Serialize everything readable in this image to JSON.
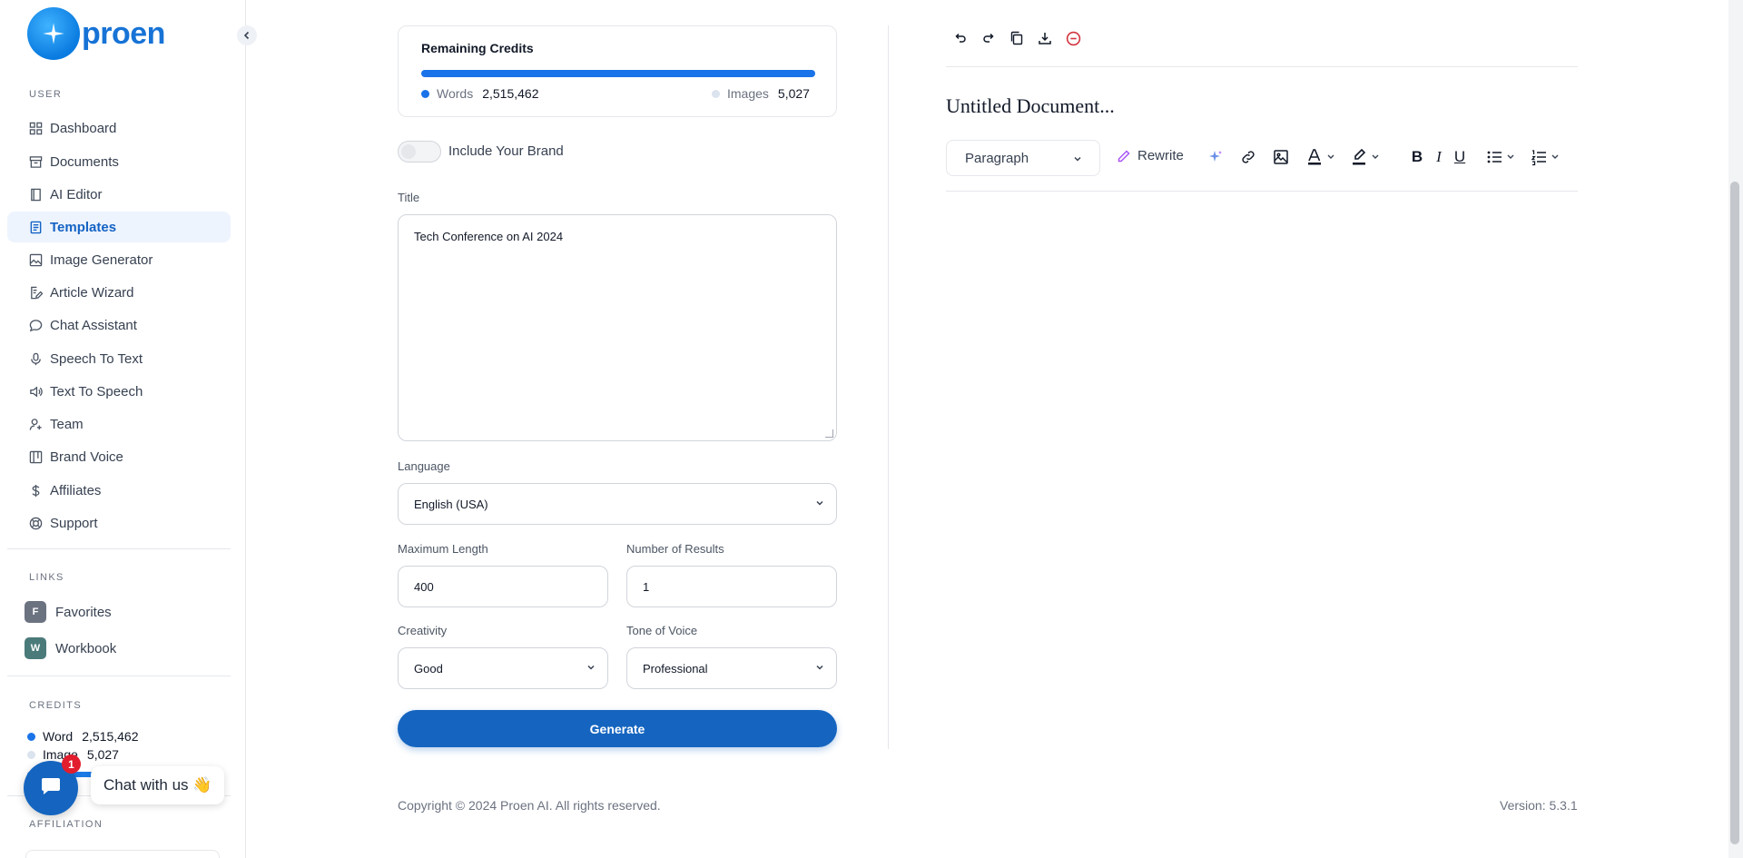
{
  "brand": {
    "name": "proen"
  },
  "sidebar": {
    "user_label": "USER",
    "items": [
      {
        "label": "Dashboard",
        "icon": "grid-icon"
      },
      {
        "label": "Documents",
        "icon": "archive-icon"
      },
      {
        "label": "AI Editor",
        "icon": "notebook-icon"
      },
      {
        "label": "Templates",
        "icon": "file-text-icon",
        "active": true
      },
      {
        "label": "Image Generator",
        "icon": "image-icon"
      },
      {
        "label": "Article Wizard",
        "icon": "file-edit-icon"
      },
      {
        "label": "Chat Assistant",
        "icon": "chat-icon"
      },
      {
        "label": "Speech To Text",
        "icon": "mic-icon"
      },
      {
        "label": "Text To Speech",
        "icon": "speaker-icon"
      },
      {
        "label": "Team",
        "icon": "user-plus-icon"
      },
      {
        "label": "Brand Voice",
        "icon": "layout-icon"
      },
      {
        "label": "Affiliates",
        "icon": "dollar-icon"
      },
      {
        "label": "Support",
        "icon": "lifebuoy-icon"
      }
    ],
    "links_label": "LINKS",
    "links": [
      {
        "badge": "F",
        "label": "Favorites",
        "color": "#6b7280"
      },
      {
        "badge": "W",
        "label": "Workbook",
        "color": "#4b7a7a"
      }
    ],
    "credits_label": "CREDITS",
    "credits": {
      "word_label": "Word",
      "word_value": "2,515,462",
      "image_label": "Image",
      "image_value": "5,027"
    },
    "affiliation_label": "AFFILIATION"
  },
  "chat_widget": {
    "label": "Chat with us 👋",
    "count": "1"
  },
  "form": {
    "credits_card": {
      "title": "Remaining Credits",
      "words_label": "Words",
      "words_value": "2,515,462",
      "images_label": "Images",
      "images_value": "5,027",
      "words_share": 1.0
    },
    "brand_toggle": {
      "label": "Include Your Brand",
      "on": false
    },
    "title_label": "Title",
    "title_value": "Tech Conference on AI 2024",
    "language_label": "Language",
    "language_value": "English (USA)",
    "max_length_label": "Maximum Length",
    "max_length_value": "400",
    "results_label": "Number of Results",
    "results_value": "1",
    "creativity_label": "Creativity",
    "creativity_value": "Good",
    "tone_label": "Tone of Voice",
    "tone_value": "Professional",
    "generate_label": "Generate"
  },
  "editor": {
    "doc_title": "Untitled Document...",
    "block_format": "Paragraph",
    "rewrite_label": "Rewrite"
  },
  "footer": {
    "copyright": "Copyright © 2024 Proen AI. All rights reserved.",
    "version": "Version: 5.3.1"
  },
  "colors": {
    "accent": "#1565c0",
    "credit_bar": "#1a73e8",
    "image_dot": "#dbe3ee"
  }
}
